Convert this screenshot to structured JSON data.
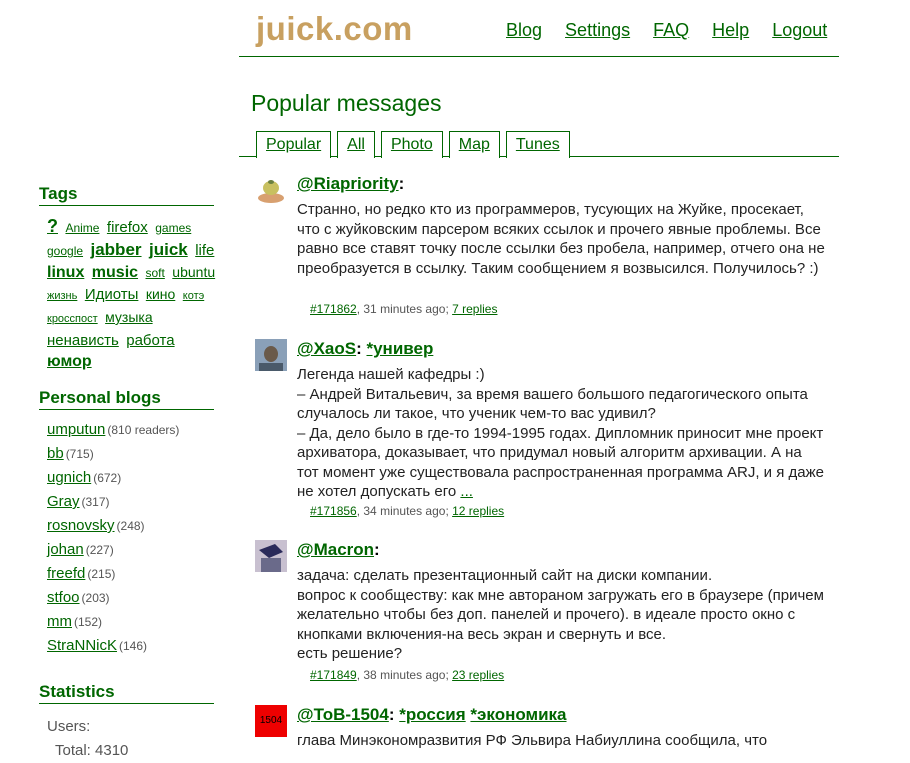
{
  "header": {
    "logo": "juick.com",
    "nav": [
      "Blog",
      "Settings",
      "FAQ",
      "Help",
      "Logout"
    ]
  },
  "page_title": "Popular messages",
  "tabs": [
    "Popular",
    "All",
    "Photo",
    "Map",
    "Tunes"
  ],
  "sidebar": {
    "tags_title": "Tags",
    "tags": [
      "?",
      "Anime",
      "firefox",
      "games",
      "google",
      "jabber",
      "juick",
      "life",
      "linux",
      "music",
      "soft",
      "ubuntu",
      "жизнь",
      "Идиоты",
      "кино",
      "котэ",
      "кросспост",
      "музыка",
      "ненависть",
      "работа",
      "юмор"
    ],
    "blogs_title": "Personal blogs",
    "blogs": [
      {
        "name": "umputun",
        "count": "(810 readers)"
      },
      {
        "name": "bb",
        "count": "(715)"
      },
      {
        "name": "ugnich",
        "count": "(672)"
      },
      {
        "name": "Gray",
        "count": "(317)"
      },
      {
        "name": "rosnovsky",
        "count": "(248)"
      },
      {
        "name": "johan",
        "count": "(227)"
      },
      {
        "name": "freefd",
        "count": "(215)"
      },
      {
        "name": "stfoo",
        "count": "(203)"
      },
      {
        "name": "mm",
        "count": "(152)"
      },
      {
        "name": "StraNNicK",
        "count": "(146)"
      }
    ],
    "stats_title": "Statistics",
    "stats_users": "Users:",
    "stats_total": "Total: 4310"
  },
  "messages": [
    {
      "user": "@Riapriority",
      "tags": [],
      "body": "Странно, но редко кто из программеров, тусующих на Жуйке, просекает, что с жуйковским парсером всяких ссылок и прочего явные проблемы. Все равно все ставят точку после ссылки без пробела, например, отчего она не преобразуется в ссылку. Таким сообщением я возвысился. Получилось? :)",
      "id": "#171862",
      "time": ", 31 minutes ago; ",
      "replies": "7 replies"
    },
    {
      "user": "@XaoS",
      "tags": [
        "*универ"
      ],
      "body": "Легенда нашей кафедры :)\n– Андрей Витальевич, за время вашего большого педагогического опыта случалось ли такое, что ученик чем-то вас удивил?\n– Да, дело было в где-то 1994-1995 годах. Дипломник приносит мне проект архиватора, доказывает, что придумал новый алгоритм архивации. А на тот момент уже существовала распространенная программа ARJ, и я даже не хотел допускать его",
      "more": "...",
      "id": "#171856",
      "time": ", 34 minutes ago; ",
      "replies": "12 replies"
    },
    {
      "user": "@Macron",
      "tags": [],
      "body": "задача: сделать презентационный сайт на диски компании.\nвопрос к сообществу: как мне автораном загружать его в браузере (причем желательно чтобы без доп. панелей и прочего). в идеале просто окно с кнопками включения-на весь экран и свернуть и все.\nесть решение?",
      "id": "#171849",
      "time": ", 38 minutes ago; ",
      "replies": "23 replies"
    },
    {
      "user": "@ToB-1504",
      "avatar_text": "1504",
      "tags": [
        "*россия",
        "*экономика"
      ],
      "body": "глава Минэкономразвития РФ Эльвира Набиуллина сообщила, что"
    }
  ]
}
